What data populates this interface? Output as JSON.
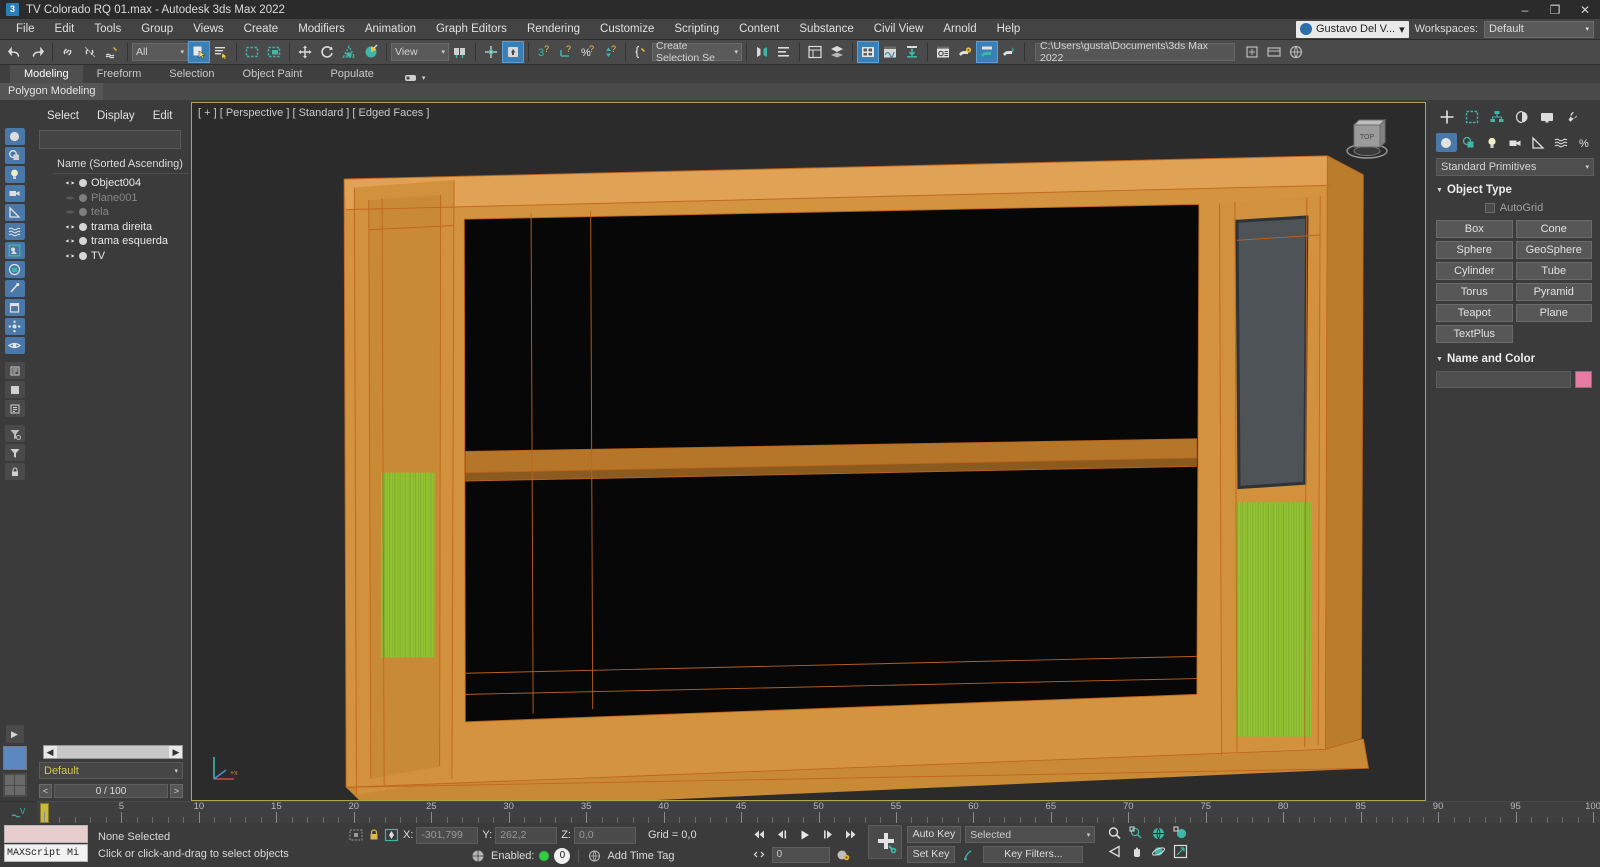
{
  "window": {
    "title": "TV Colorado RQ 01.max - Autodesk 3ds Max 2022",
    "app_badge": "3",
    "minimize": "–",
    "maximize": "❐",
    "close": "✕"
  },
  "menubar": {
    "items": [
      "File",
      "Edit",
      "Tools",
      "Group",
      "Views",
      "Create",
      "Modifiers",
      "Animation",
      "Graph Editors",
      "Rendering",
      "Customize",
      "Scripting",
      "Content",
      "Substance",
      "Civil View",
      "Arnold",
      "Help"
    ],
    "user": "Gustavo Del V...",
    "workspaces_label": "Workspaces:",
    "workspace_value": "Default"
  },
  "toolbar": {
    "selection_filter": "All",
    "reference_coord": "View",
    "selection_set": "Create Selection Se",
    "project_path": "C:\\Users\\gusta\\Documents\\3ds Max 2022"
  },
  "ribbon": {
    "tabs": [
      "Modeling",
      "Freeform",
      "Selection",
      "Object Paint",
      "Populate"
    ],
    "active_tab": "Modeling",
    "subtab": "Polygon Modeling"
  },
  "scene_explorer": {
    "menus": [
      "Select",
      "Display",
      "Edit"
    ],
    "search_value": "",
    "column_header": "Name (Sorted Ascending)",
    "objects": [
      {
        "name": "Object004",
        "visible": true
      },
      {
        "name": "Plane001",
        "visible": false
      },
      {
        "name": "tela",
        "visible": false
      },
      {
        "name": "trama direita",
        "visible": true
      },
      {
        "name": "trama esquerda",
        "visible": true
      },
      {
        "name": "TV",
        "visible": true
      }
    ],
    "layer": "Default",
    "frame_counter": "0 / 100",
    "prev_btn": "<",
    "next_btn": ">"
  },
  "viewport": {
    "label": "[ + ] [ Perspective ] [ Standard ] [ Edged Faces ]",
    "background": "#2b2b2b",
    "wood_color": "#d4943f",
    "wood_color_dark": "#c2862f",
    "wood_color_light": "#dda14c",
    "mesh_green": "#93c233",
    "screen_grey": "#4e5358",
    "edge_color": "#b85c18",
    "interior_black": "#050505",
    "viewcube_label": "TOP"
  },
  "command_panel": {
    "category": "Standard Primitives",
    "rollout_object_type": "Object Type",
    "autogrid": "AutoGrid",
    "buttons": [
      "Box",
      "Cone",
      "Sphere",
      "GeoSphere",
      "Cylinder",
      "Tube",
      "Torus",
      "Pyramid",
      "Teapot",
      "Plane",
      "TextPlus"
    ],
    "rollout_name_color": "Name and Color",
    "name_value": "",
    "color_swatch": "#e87ba4"
  },
  "timeline": {
    "ticks": [
      0,
      5,
      10,
      15,
      20,
      25,
      30,
      35,
      40,
      45,
      50,
      55,
      60,
      65,
      70,
      75,
      80,
      85,
      90,
      95,
      100
    ],
    "current_frame": 0,
    "range_start": 0,
    "range_end": 100
  },
  "statusbar": {
    "maxscript_label": "MAXScript Mi",
    "selection_status": "None Selected",
    "prompt": "Click or click-and-drag to select objects",
    "x_label": "X:",
    "x_value": "-301,799",
    "y_label": "Y:",
    "y_value": "262,2",
    "z_label": "Z:",
    "z_value": "0,0",
    "grid": "Grid = 0,0",
    "enabled_label": "Enabled:",
    "enabled_count": "0",
    "add_time_tag": "Add Time Tag",
    "auto_key": "Auto Key",
    "set_key": "Set Key",
    "key_mode": "Selected",
    "key_filters": "Key Filters...",
    "frame_field": "0"
  }
}
